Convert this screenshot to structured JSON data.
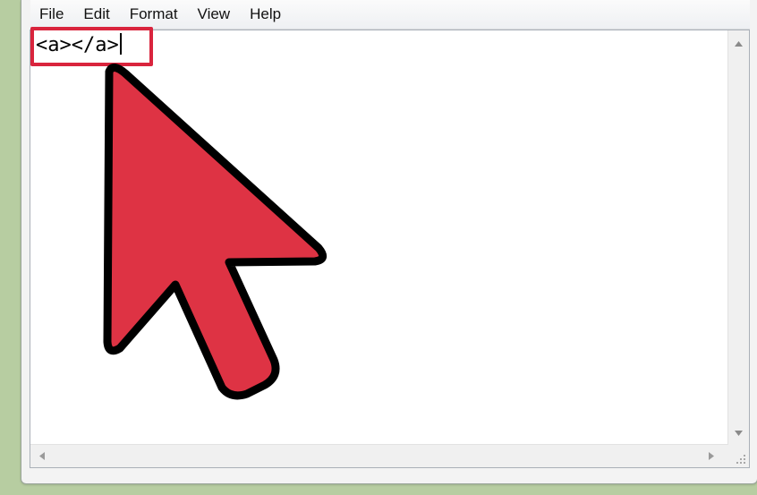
{
  "menubar": {
    "items": [
      {
        "label": "File"
      },
      {
        "label": "Edit"
      },
      {
        "label": "Format"
      },
      {
        "label": "View"
      },
      {
        "label": "Help"
      }
    ]
  },
  "editor": {
    "content": "<a></a>"
  },
  "icons": {
    "scroll_up": "chevron-up-icon",
    "scroll_down": "chevron-down-icon",
    "scroll_left": "chevron-left-icon",
    "scroll_right": "chevron-right-icon",
    "pointer": "mouse-pointer-icon",
    "resize": "size-grip-icon"
  },
  "colors": {
    "background": "#b7cda1",
    "highlight": "#d9243d",
    "pointer_fill": "#de3344",
    "pointer_outline": "#000000"
  }
}
